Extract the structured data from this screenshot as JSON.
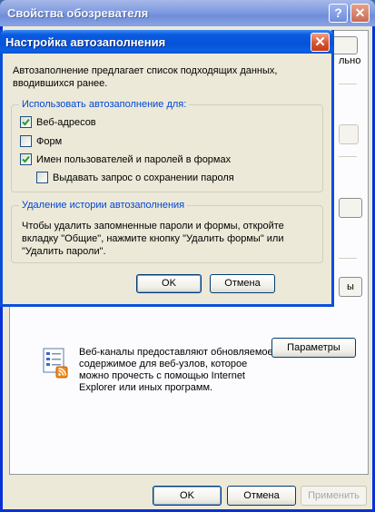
{
  "outer_window": {
    "title": "Свойства обозревателя",
    "partial_tab_label": "льно",
    "feeds_text": "Веб-каналы предоставляют обновляемое содержимое для веб-узлов, которое можно прочесть с помощью Internet Explorer или иных программ.",
    "feeds_settings_button": "Параметры",
    "partial_button_label": "ы",
    "ok_button": "OK",
    "cancel_button": "Отмена",
    "apply_button": "Применить"
  },
  "dialog": {
    "title": "Настройка автозаполнения",
    "intro": "Автозаполнение предлагает список подходящих данных, вводившихся ранее.",
    "use_group": {
      "title": "Использовать автозаполнение для:",
      "options": [
        {
          "label": "Веб-адресов",
          "checked": true
        },
        {
          "label": "Форм",
          "checked": false
        },
        {
          "label": "Имен пользователей и паролей в формах",
          "checked": true
        },
        {
          "label": "Выдавать запрос о сохранении пароля",
          "checked": false
        }
      ]
    },
    "delete_group": {
      "title": "Удаление истории автозаполнения",
      "text": "Чтобы удалить запомненные пароли и формы, откройте вкладку \"Общие\", нажмите кнопку \"Удалить формы\" или \"Удалить пароли\"."
    },
    "ok_button": "OK",
    "cancel_button": "Отмена"
  },
  "colors": {
    "dialog_titlebar": "#0552d7",
    "inactive_titlebar": "#7f9be0",
    "group_title": "#0046d5",
    "checkmark": "#21a121",
    "window_face": "#ece9d8"
  }
}
